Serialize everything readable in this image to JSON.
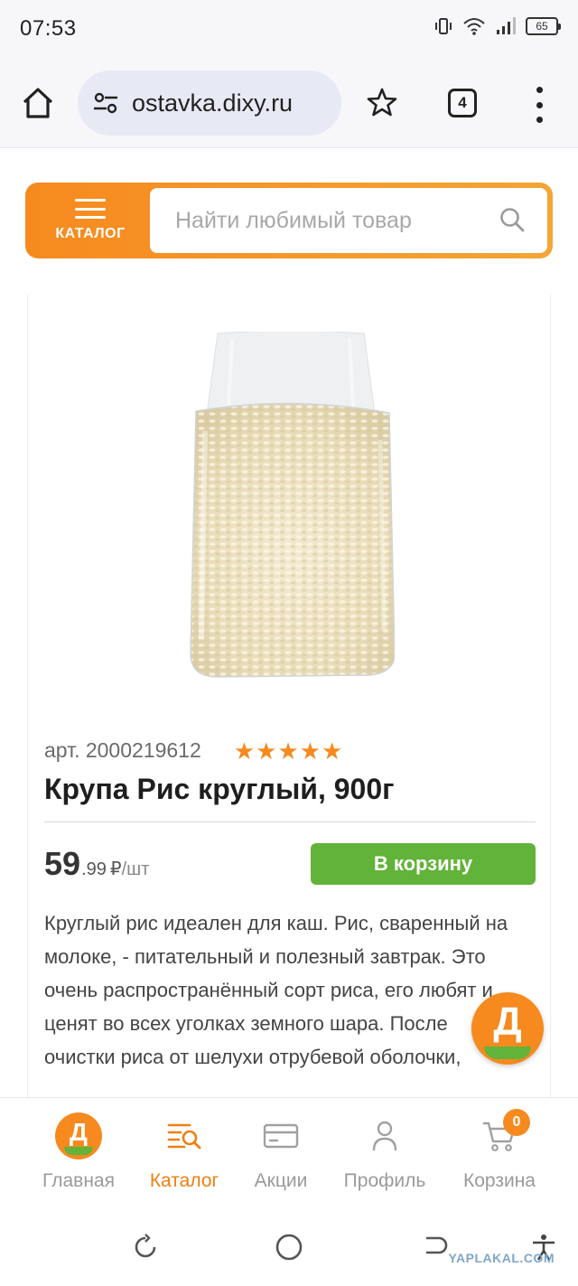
{
  "status_bar": {
    "time": "07:53",
    "battery": "65"
  },
  "browser": {
    "url": "ostavka.dixy.ru",
    "tab_count": "4"
  },
  "header": {
    "catalog_label": "КАТАЛОГ",
    "search_placeholder": "Найти любимый товар"
  },
  "product": {
    "article": "арт. 2000219612",
    "rating": 5,
    "title": "Крупа Рис круглый, 900г",
    "price_int": "59",
    "price_frac": ".99",
    "currency": "₽",
    "unit": "/шт",
    "cart_button": "В корзину",
    "description": "Круглый рис идеален для каш. Рис, сваренный на молоке, - питательный и полезный завтрак. Это очень распространённый сорт риса, его любят и ценят во всех уголках земного шара. После очистки риса от шелухи отрубевой оболочки,"
  },
  "fab": {
    "logo_letter": "Д"
  },
  "bottom_nav": {
    "items": [
      {
        "label": "Главная",
        "icon": "dixy-logo-icon"
      },
      {
        "label": "Каталог",
        "icon": "catalog-search-icon"
      },
      {
        "label": "Акции",
        "icon": "card-icon"
      },
      {
        "label": "Профиль",
        "icon": "user-icon"
      },
      {
        "label": "Корзина",
        "icon": "cart-icon"
      }
    ],
    "active": "Каталог",
    "cart_count": "0",
    "home_letter": "Д"
  },
  "watermark": "YAPLAKAL.COM",
  "colors": {
    "brand_orange": "#f68a1f",
    "brand_green": "#62b339",
    "active_nav": "#f07f13"
  }
}
